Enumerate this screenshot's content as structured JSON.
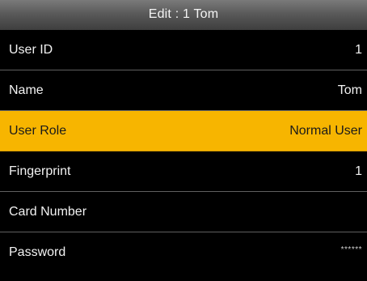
{
  "window": {
    "title": "Edit : 1 Tom"
  },
  "rows": [
    {
      "label": "User ID",
      "value": "1"
    },
    {
      "label": "Name",
      "value": "Tom"
    },
    {
      "label": "User Role",
      "value": "Normal User",
      "selected": true
    },
    {
      "label": "Fingerprint",
      "value": "1"
    },
    {
      "label": "Card Number",
      "value": ""
    },
    {
      "label": "Password",
      "value": "******"
    }
  ],
  "colors": {
    "highlight": "#f7b500",
    "background": "#000000",
    "title_bar": "#5a5a5a",
    "divider": "#5f5f5f"
  }
}
